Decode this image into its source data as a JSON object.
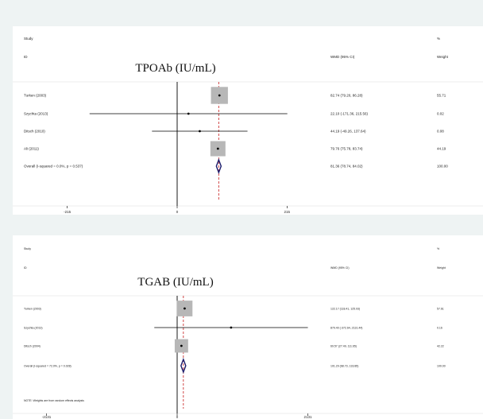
{
  "chart_data": [
    {
      "type": "forest",
      "title": "TPOAb (IU/mL)",
      "header": {
        "study": "Study",
        "id": "ID",
        "ci": "WMD (95% CI)",
        "pct": "%",
        "weight": "Weight"
      },
      "xlim": [
        -300,
        300
      ],
      "ticks": [
        {
          "value": -215,
          "label": "-215"
        },
        {
          "value": 0,
          "label": "0"
        },
        {
          "value": 215,
          "label": "215"
        }
      ],
      "overall_line": 81.36,
      "studies": [
        {
          "label": "Turken (2003)",
          "est": 82.74,
          "lo": 79.2,
          "hi": 86.28,
          "ci_text": "82.74 (79.20, 86.28)",
          "weight": 55.71,
          "weight_text": "55.71"
        },
        {
          "label": "Szychta (2013)",
          "est": 22.1,
          "lo": -171.36,
          "hi": 215.56,
          "ci_text": "22.10 (-171.36, 215.56)",
          "weight": 0.02,
          "weight_text": "0.02"
        },
        {
          "label": "Ditsch (2010)",
          "est": 44.19,
          "lo": -49.26,
          "hi": 137.64,
          "ci_text": "44.19 (-49.26, 137.64)",
          "weight": 0.08,
          "weight_text": "0.08"
        },
        {
          "label": "Ali (2011)",
          "est": 79.76,
          "lo": 75.78,
          "hi": 83.74,
          "ci_text": "79.76 (75.78, 83.74)",
          "weight": 44.19,
          "weight_text": "44.19"
        }
      ],
      "overall": {
        "label": "Overall  (I-squared = 0.0%, p = 0.537)",
        "est": 81.36,
        "lo": 78.74,
        "hi": 84.02,
        "ci_text": "81.36 (78.74, 84.02)",
        "weight_text": "100.00"
      },
      "note": ""
    },
    {
      "type": "forest",
      "title": "TGAB (IU/mL)",
      "header": {
        "study": "Study",
        "id": "ID",
        "ci": "WMD (95% CI)",
        "pct": "%",
        "weight": "Weight"
      },
      "xlim": [
        -2500,
        2500
      ],
      "ticks": [
        {
          "value": -2131,
          "label": "-2131"
        },
        {
          "value": 0,
          "label": "0"
        },
        {
          "value": 2131,
          "label": "2131"
        }
      ],
      "overall_line": 101.29,
      "studies": [
        {
          "label": "Turken (2003)",
          "est": 122.17,
          "lo": 118.41,
          "hi": 125.93,
          "ci_text": "122.17 (118.41, 125.93)",
          "weight": 57.61,
          "weight_text": "57.61"
        },
        {
          "label": "Szychta (2013)",
          "est": 879.4,
          "lo": -372.64,
          "hi": 2131.44,
          "ci_text": "879.40 (-372.64, 2131.44)",
          "weight": 0.16,
          "weight_text": "0.16"
        },
        {
          "label": "Ditsch (2004)",
          "est": 69.57,
          "lo": 27.49,
          "hi": 111.65,
          "ci_text": "69.57 (27.49, 111.65)",
          "weight": 42.22,
          "weight_text": "42.22"
        }
      ],
      "overall": {
        "label": "Overall  (I-squared = 72.0%, p = 0.028)",
        "est": 101.29,
        "lo": 68.73,
        "hi": 133.85,
        "ci_text": "101.29 (68.73, 133.85)",
        "weight_text": "100.00"
      },
      "note": "NOTE: Weights are from random effects analysis"
    }
  ],
  "colors": {
    "box": "#b7b7b7",
    "diamond": "#1c1c6b",
    "overall_line": "#cc3333",
    "background": "#eef3f3",
    "panel": "#ffffff",
    "text": "#222222",
    "rule": "#dcdcdc"
  }
}
